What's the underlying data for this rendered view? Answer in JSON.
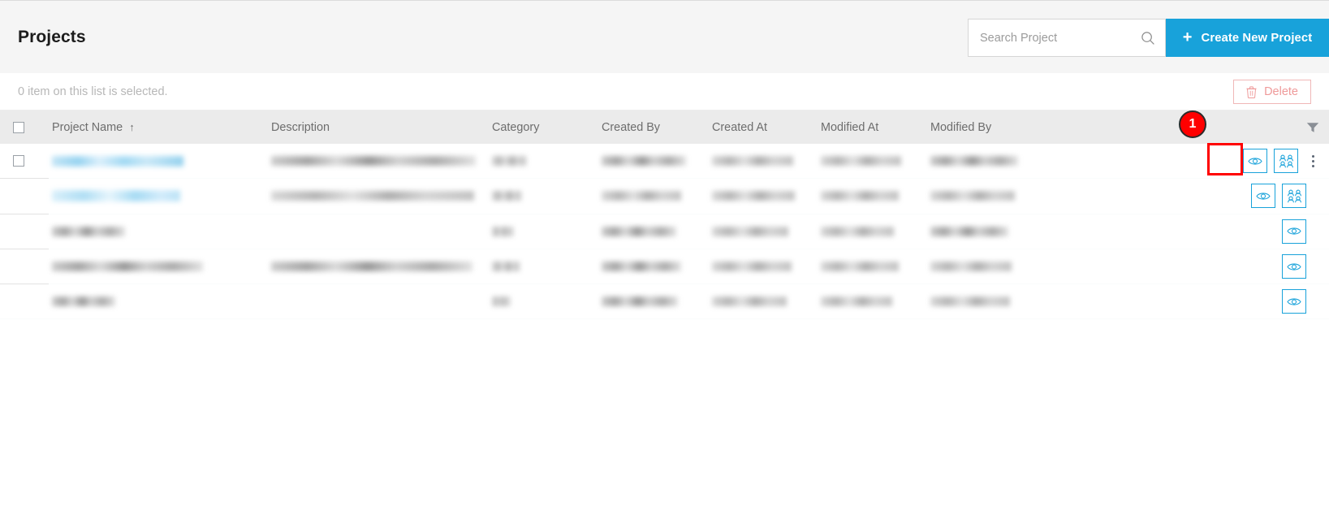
{
  "header": {
    "title": "Projects",
    "search": {
      "placeholder": "Search Project",
      "value": "",
      "icon": "search-icon"
    },
    "create_button": {
      "label": "Create New Project",
      "icon": "plus-icon",
      "color": "#18a2da"
    }
  },
  "selection_bar": {
    "status_text": "0 item on this list is selected.",
    "delete_button": {
      "label": "Delete",
      "icon": "trash-icon",
      "color": "#ef9a9a"
    }
  },
  "table": {
    "columns": [
      {
        "key": "check",
        "label": "",
        "icon": "checkbox-icon"
      },
      {
        "key": "name",
        "label": "Project Name",
        "sort": "↑"
      },
      {
        "key": "description",
        "label": "Description"
      },
      {
        "key": "category",
        "label": "Category"
      },
      {
        "key": "created_by",
        "label": "Created By"
      },
      {
        "key": "created_at",
        "label": "Created At"
      },
      {
        "key": "modified_at",
        "label": "Modified At"
      },
      {
        "key": "modified_by",
        "label": "Modified By"
      },
      {
        "key": "actions",
        "label": "",
        "icon": "filter-icon"
      }
    ],
    "rows": [
      {
        "id": "row-1",
        "has_checkbox": true,
        "checked": false,
        "name_redacted": true,
        "name_highlighted": true,
        "cells": {
          "name_w": 162,
          "desc_w": 252,
          "cat_w": 42,
          "cby_w": 104,
          "cat2_w": 100,
          "mat_w": 99,
          "mby_w": 108
        },
        "actions": [
          "view-icon",
          "members-icon",
          "more-icon"
        ]
      },
      {
        "id": "row-2",
        "has_checkbox": false,
        "name_redacted": true,
        "name_highlighted": true,
        "cells": {
          "name_w": 158,
          "desc_w": 250,
          "cat_w": 36,
          "cby_w": 98,
          "cat2_w": 102,
          "mat_w": 96,
          "mby_w": 104
        },
        "actions": [
          "view-icon",
          "members-icon"
        ]
      },
      {
        "id": "row-3",
        "has_checkbox": false,
        "name_redacted": true,
        "name_highlighted": false,
        "cells": {
          "name_w": 90,
          "desc_w": 0,
          "cat_w": 26,
          "cby_w": 92,
          "cat2_w": 94,
          "mat_w": 90,
          "mby_w": 96
        },
        "actions": [
          "view-icon"
        ]
      },
      {
        "id": "row-4",
        "has_checkbox": false,
        "name_redacted": true,
        "name_highlighted": false,
        "cells": {
          "name_w": 186,
          "desc_w": 248,
          "cat_w": 34,
          "cby_w": 98,
          "cat2_w": 98,
          "mat_w": 96,
          "mby_w": 100
        },
        "actions": [
          "view-icon"
        ]
      },
      {
        "id": "row-5",
        "has_checkbox": false,
        "name_redacted": true,
        "name_highlighted": false,
        "cells": {
          "name_w": 78,
          "desc_w": 0,
          "cat_w": 22,
          "cby_w": 94,
          "cat2_w": 92,
          "mat_w": 88,
          "mby_w": 98
        },
        "actions": [
          "view-icon"
        ]
      }
    ]
  },
  "annotation": {
    "step_number": "1",
    "highlight_target": "members-icon-button",
    "highlight_color": "#ff0000"
  }
}
